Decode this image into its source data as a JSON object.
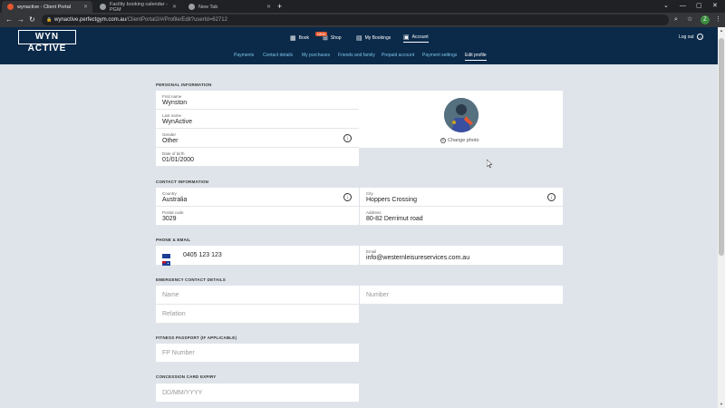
{
  "browser": {
    "tabs": [
      {
        "title": "wynactive - Client Portal",
        "favicon_color": "#e4572e",
        "active": true
      },
      {
        "title": "Facility booking calendar - PGM",
        "favicon_color": "#9aa0a6",
        "active": false
      },
      {
        "title": "New Tab",
        "favicon_color": "#9aa0a6",
        "active": false
      }
    ],
    "url_host": "wynactive.perfectgym.com.au",
    "url_path": "/ClientPortal2/#/Profile/Edit?userId=62712",
    "profile_initial": "Z"
  },
  "site": {
    "logo": "WYN ACTIVE",
    "nav": [
      {
        "label": "Book",
        "icon": "calendar-icon"
      },
      {
        "label": "Shop",
        "icon": "cart-icon",
        "badge": "NEW"
      },
      {
        "label": "My Bookings",
        "icon": "bookings-icon"
      },
      {
        "label": "Account",
        "icon": "account-icon"
      }
    ],
    "logout": "Log out",
    "subnav": [
      "Payments",
      "Contact details",
      "My purchases",
      "Friends and family",
      "Prepaid account",
      "Payment settings",
      "Edit profile"
    ]
  },
  "form": {
    "personal": {
      "title": "PERSONAL INFORMATION",
      "first_name_label": "First name",
      "first_name": "Wynston",
      "last_name_label": "Last name",
      "last_name": "WynActive",
      "gender_label": "Gender",
      "gender": "Other",
      "dob_label": "Date of birth",
      "dob": "01/01/2000",
      "change_photo": "Change photo"
    },
    "contact": {
      "title": "CONTACT INFORMATION",
      "country_label": "Country",
      "country": "Australia",
      "city_label": "City",
      "city": "Hoppers Crossing",
      "postal_label": "Postal code",
      "postal": "3029",
      "address_label": "Address",
      "address": "80-82 Derrimut road"
    },
    "phone_email": {
      "title": "PHONE & EMAIL",
      "phone": "0405 123 123",
      "email_label": "Email",
      "email": "info@westernleisureservices.com.au"
    },
    "emergency": {
      "title": "EMERGENCY CONTACT DETAILS",
      "name_placeholder": "Name",
      "number_placeholder": "Number",
      "relation_placeholder": "Relation"
    },
    "fitness": {
      "title": "FITNESS PASSPORT (IF APPLICABLE)",
      "placeholder": "FP Number"
    },
    "concession": {
      "title": "CONCESSION CARD EXPIRY",
      "placeholder": "DD/MM/YYYY"
    }
  }
}
